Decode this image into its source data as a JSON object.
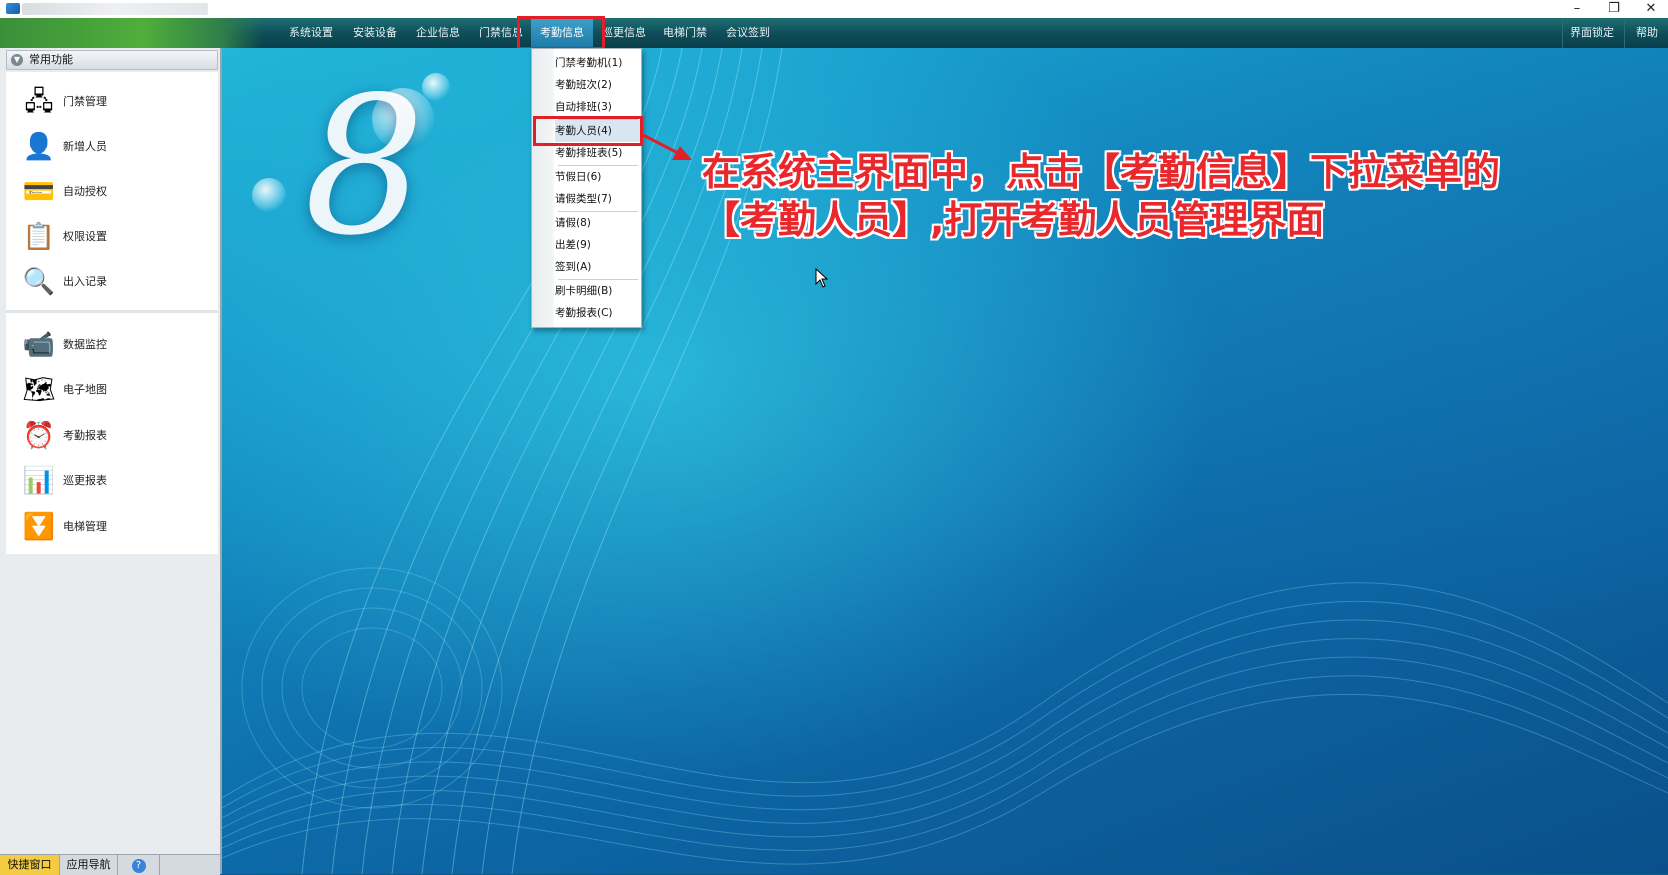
{
  "window": {
    "minimize_glyph": "–",
    "restore_glyph": "❐",
    "close_glyph": "✕"
  },
  "menubar": {
    "items": [
      {
        "label": "系统设置"
      },
      {
        "label": "安装设备"
      },
      {
        "label": "企业信息"
      },
      {
        "label": "门禁信息"
      },
      {
        "label": "考勤信息"
      },
      {
        "label": "巡更信息"
      },
      {
        "label": "电梯门禁"
      },
      {
        "label": "会议签到"
      }
    ],
    "right_items": [
      {
        "label": "界面锁定"
      },
      {
        "label": "帮助"
      }
    ]
  },
  "dropdown": {
    "items": [
      {
        "label": "门禁考勤机(1)"
      },
      {
        "label": "考勤班次(2)"
      },
      {
        "label": "自动排班(3)"
      },
      {
        "label": "考勤人员(4)"
      },
      {
        "label": "考勤排班表(5)"
      },
      {
        "label": "节假日(6)"
      },
      {
        "label": "请假类型(7)"
      },
      {
        "label": "请假(8)"
      },
      {
        "label": "出差(9)"
      },
      {
        "label": "签到(A)"
      },
      {
        "label": "刷卡明细(B)"
      },
      {
        "label": "考勤报表(C)"
      }
    ]
  },
  "left_panel": {
    "title": "常用功能",
    "toggle_glyph": "▼",
    "items": [
      {
        "label": "门禁管理",
        "icon": "door-control-icon",
        "glyph": "🖧"
      },
      {
        "label": "新增人员",
        "icon": "add-person-icon",
        "glyph": "👤"
      },
      {
        "label": "自动授权",
        "icon": "auto-auth-icon",
        "glyph": "💳"
      },
      {
        "label": "权限设置",
        "icon": "permission-icon",
        "glyph": "📋"
      },
      {
        "label": "出入记录",
        "icon": "access-record-icon",
        "glyph": "🔍"
      },
      {
        "label": "数据监控",
        "icon": "camera-monitor-icon",
        "glyph": "📹"
      },
      {
        "label": "电子地图",
        "icon": "e-map-icon",
        "glyph": "🗺"
      },
      {
        "label": "考勤报表",
        "icon": "attendance-report-icon",
        "glyph": "⏰"
      },
      {
        "label": "巡更报表",
        "icon": "patrol-report-icon",
        "glyph": "📊"
      },
      {
        "label": "电梯管理",
        "icon": "elevator-icon",
        "glyph": "⏬"
      }
    ]
  },
  "bottom_tabs": [
    {
      "label": "快捷窗口"
    },
    {
      "label": "应用导航"
    },
    {
      "label": "?"
    }
  ],
  "desktop": {
    "logo_text": "8",
    "annotation_line1": "在系统主界面中，点击【考勤信息】下拉菜单的",
    "annotation_line2": "【考勤人员】,打开考勤人员管理界面"
  },
  "colors": {
    "highlight_red": "#e21f26",
    "annotation_red": "#e8282c",
    "active_tab": "#f3cc43"
  }
}
